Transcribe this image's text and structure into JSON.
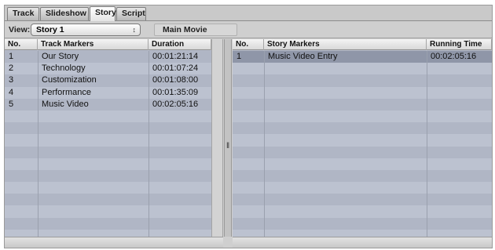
{
  "tabs": [
    {
      "label": "Track",
      "active": false
    },
    {
      "label": "Slideshow",
      "active": false
    },
    {
      "label": "Story",
      "active": true
    },
    {
      "label": "Script",
      "active": false
    }
  ],
  "view": {
    "label": "View:",
    "selected": "Story 1",
    "context": "Main Movie"
  },
  "track_table": {
    "headers": [
      "No.",
      "Track Markers",
      "Duration"
    ],
    "rows": [
      [
        "1",
        "Our Story",
        "00:01:21:14"
      ],
      [
        "2",
        "Technology",
        "00:01:07:24"
      ],
      [
        "3",
        "Customization",
        "00:01:08:00"
      ],
      [
        "4",
        "Performance",
        "00:01:35:09"
      ],
      [
        "5",
        "Music Video",
        "00:02:05:16"
      ]
    ]
  },
  "story_table": {
    "headers": [
      "No.",
      "Story Markers",
      "Running Time"
    ],
    "rows": [
      [
        "1",
        "Music Video Entry",
        "00:02:05:16"
      ]
    ]
  },
  "icons": {
    "popup_arrows": "up-down-arrows-icon",
    "splitter_grip": "splitter-grip-icon"
  }
}
